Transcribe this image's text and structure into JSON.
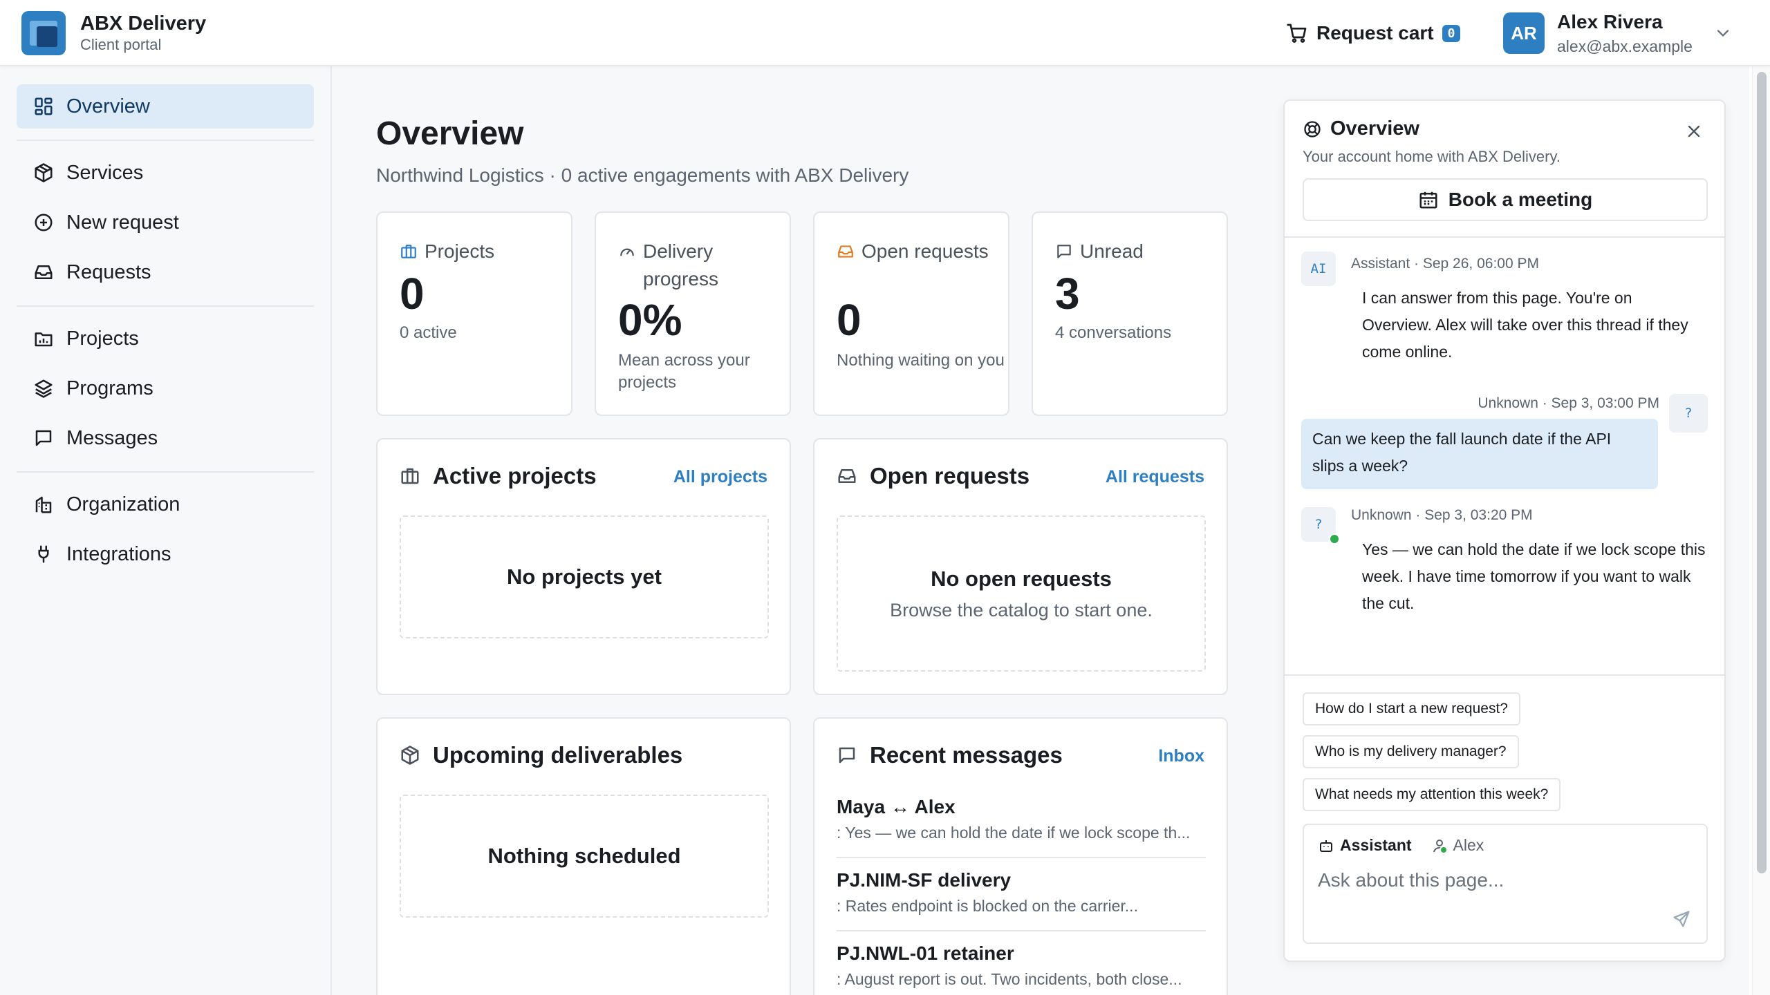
{
  "brand": {
    "name": "ABX Delivery",
    "sub": "Client portal"
  },
  "header": {
    "cart_label": "Request cart",
    "cart_count": "0"
  },
  "user": {
    "initials": "AR",
    "name": "Alex Rivera",
    "email": "alex@abx.example"
  },
  "sidebar": {
    "items": [
      {
        "label": "Overview",
        "icon": "layout-grid-icon"
      },
      {
        "label": "Services",
        "icon": "package-icon"
      },
      {
        "label": "New request",
        "icon": "plus-circle-icon"
      },
      {
        "label": "Requests",
        "icon": "inbox-icon"
      },
      {
        "label": "Projects",
        "icon": "folder-chart-icon"
      },
      {
        "label": "Programs",
        "icon": "layers-icon"
      },
      {
        "label": "Messages",
        "icon": "message-square-icon"
      },
      {
        "label": "Organization",
        "icon": "building-icon"
      },
      {
        "label": "Integrations",
        "icon": "plug-icon"
      }
    ]
  },
  "page": {
    "title": "Overview",
    "subtitle": "Northwind Logistics · 0 active engagements with ABX Delivery"
  },
  "stats": [
    {
      "label": "Projects",
      "value": "0",
      "note": "0 active"
    },
    {
      "label": "Delivery progress",
      "value": "0%",
      "note": "Mean across your projects"
    },
    {
      "label": "Open requests",
      "value": "0",
      "note": "Nothing waiting on you"
    },
    {
      "label": "Unread",
      "value": "3",
      "note": "4 conversations"
    }
  ],
  "panels": {
    "active_projects": {
      "title": "Active projects",
      "link": "All projects",
      "empty": "No projects yet"
    },
    "open_requests": {
      "title": "Open requests",
      "link": "All requests",
      "empty": "No open requests",
      "empty_sub": "Browse the catalog to start one."
    },
    "upcoming": {
      "title": "Upcoming deliverables",
      "empty": "Nothing scheduled"
    },
    "recent_messages": {
      "title": "Recent messages",
      "link": "Inbox",
      "items": [
        {
          "title": "Maya ↔ Alex",
          "preview": ": Yes — we can hold the date if we lock scope th..."
        },
        {
          "title": "PJ.NIM-SF delivery",
          "preview": ": Rates endpoint is blocked on the carrier..."
        },
        {
          "title": "PJ.NWL-01 retainer",
          "preview": ": August report is out. Two incidents, both close..."
        }
      ]
    }
  },
  "assistant": {
    "title": "Overview",
    "subtitle": "Your account home with ABX Delivery.",
    "book_label": "Book a meeting",
    "messages": [
      {
        "avatar": "AI",
        "meta": "Assistant · Sep 26, 06:00 PM",
        "text": "I can answer from this page. You're on Overview. Alex will take over this thread if they come online."
      },
      {
        "avatar": "?",
        "meta": "Unknown · Sep 3, 03:00 PM",
        "text": "Can we keep the fall launch date if the API slips a week?"
      },
      {
        "avatar": "?",
        "meta": "Unknown · Sep 3, 03:20 PM",
        "text": "Yes — we can hold the date if we lock scope this week. I have time tomorrow if you want to walk the cut."
      }
    ],
    "suggestions": [
      "How do I start a new request?",
      "Who is my delivery manager?",
      "What needs my attention this week?"
    ],
    "composer": {
      "mode_assistant": "Assistant",
      "mode_human": "Alex",
      "placeholder": "Ask about this page..."
    }
  },
  "colors": {
    "accent": "#2e7fc1",
    "active_nav": "#dcebf7",
    "online": "#2eaa4f",
    "orange_icon": "#e07a1f"
  }
}
